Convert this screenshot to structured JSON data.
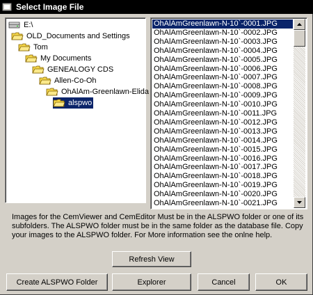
{
  "window": {
    "title": "Select Image File"
  },
  "folder_tree": {
    "items": [
      {
        "label": "E:\\",
        "icon": "drive-icon"
      },
      {
        "label": "OLD_Documents and Settings",
        "icon": "folder-open-icon"
      },
      {
        "label": "Tom",
        "icon": "folder-open-icon"
      },
      {
        "label": "My Documents",
        "icon": "folder-open-icon"
      },
      {
        "label": "GENEALOGY CDS",
        "icon": "folder-open-icon"
      },
      {
        "label": "Allen-Co-Oh",
        "icon": "folder-open-icon"
      },
      {
        "label": "OhAlAm-Greenlawn-Elida",
        "icon": "folder-open-icon"
      },
      {
        "label": "alspwo",
        "icon": "folder-open-icon",
        "selected": true
      }
    ]
  },
  "file_list": {
    "files": [
      "OhAlAmGreenlawn-N-10`-0001.JPG",
      "OhAlAmGreenlawn-N-10`-0002.JPG",
      "OhAlAmGreenlawn-N-10`-0003.JPG",
      "OhAlAmGreenlawn-N-10`-0004.JPG",
      "OhAlAmGreenlawn-N-10`-0005.JPG",
      "OhAlAmGreenlawn-N-10`-0006.JPG",
      "OhAlAmGreenlawn-N-10`-0007.JPG",
      "OhAlAmGreenlawn-N-10`-0008.JPG",
      "OhAlAmGreenlawn-N-10`-0009.JPG",
      "OhAlAmGreenlawn-N-10`-0010.JPG",
      "OhAlAmGreenlawn-N-10`-0011.JPG",
      "OhAlAmGreenlawn-N-10`-0012.JPG",
      "OhAlAmGreenlawn-N-10`-0013.JPG",
      "OhAlAmGreenlawn-N-10`-0014.JPG",
      "OhAlAmGreenlawn-N-10`-0015.JPG",
      "OhAlAmGreenlawn-N-10`-0016.JPG",
      "OhAlAmGreenlawn-N-10`-0017.JPG",
      "OhAlAmGreenlawn-N-10`-0018.JPG",
      "OhAlAmGreenlawn-N-10`-0019.JPG",
      "OhAlAmGreenlawn-N-10`-0020.JPG",
      "OhAlAmGreenlawn-N-10`-0021.JPG"
    ],
    "selected_index": 0
  },
  "help_text": "Images for the CemViewer and CemEditor Must be in the ALSPWO folder or one of its subfolders. The ALSPWO folder must be in the same folder as the database file. Copy your images to the ALSPWO folder. For More information see the onlne help.",
  "buttons": {
    "refresh": "Refresh View",
    "create_folder": "Create ALSPWO Folder",
    "explorer": "Explorer",
    "cancel": "Cancel",
    "ok": "OK"
  },
  "colors": {
    "titlebar": "#000000",
    "selection": "#0a246a",
    "dialog_face": "#d4d0c8",
    "folder": "#f5d64a"
  }
}
